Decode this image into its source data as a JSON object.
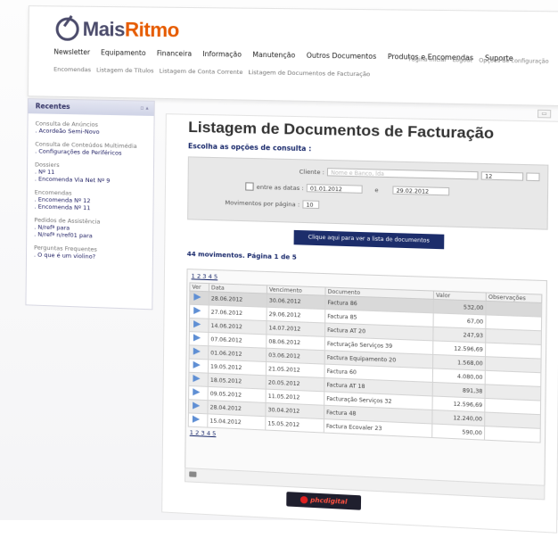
{
  "logo": {
    "part1": "Mais",
    "part2": "Ritmo"
  },
  "topnav": [
    "Newsletter",
    "Equipamento",
    "Financeira",
    "Informação",
    "Manutenção",
    "Outros Documentos",
    "Produtos e Encomendas",
    "Suporte"
  ],
  "subnav": [
    "Encomendas",
    "Listagem de Títulos",
    "Listagem de Conta Corrente",
    "Listagem de Documentos de Facturação"
  ],
  "util": [
    "Página Inicial",
    "Logout",
    "Opções de configuração"
  ],
  "sidebar": {
    "title": "Recentes",
    "groups": [
      {
        "title": "Consulta de Anúncios",
        "links": [
          ". Acordeão Semi-Novo"
        ]
      },
      {
        "title": "Consulta de Conteúdos Multimédia",
        "links": [
          ". Configurações de Periféricos"
        ]
      },
      {
        "title": "Dossiers",
        "links": [
          ". Nº 11",
          ". Encomenda Via Net Nº 9"
        ]
      },
      {
        "title": "Encomendas",
        "links": [
          ". Encomenda Nº 12",
          ". Encomenda Nº 11"
        ]
      },
      {
        "title": "Pedidos de Assistência",
        "links": [
          ". N/refª para",
          ". N/refª n/ref01 para"
        ]
      },
      {
        "title": "Perguntas Frequentes",
        "links": [
          ". O que é um violino?"
        ]
      }
    ]
  },
  "main": {
    "title": "Listagem de Documentos de Facturação",
    "subtitle": "Escolha as opções de consulta :",
    "filters": {
      "cliente_label": "Cliente :",
      "cliente_placeholder": "Nome e Banco, lda",
      "cliente_code": "12",
      "datas_label": "entre as datas :",
      "date_from": "01.01.2012",
      "date_sep": "e",
      "date_to": "29.02.2012",
      "per_page_label": "Movimentos por página :",
      "per_page": "10"
    },
    "submit_label": "Clique aqui para ver a lista de documentos",
    "count": "44 movimentos. Página 1 de 5",
    "pager": "1 2 3 4 5",
    "columns": [
      "Ver",
      "Data",
      "Vencimento",
      "Documento",
      "Valor",
      "Observações"
    ],
    "rows": [
      {
        "data": "28.06.2012",
        "venc": "30.06.2012",
        "doc": "Factura 86",
        "valor": "532,00"
      },
      {
        "data": "27.06.2012",
        "venc": "29.06.2012",
        "doc": "Factura 85",
        "valor": "67,00"
      },
      {
        "data": "14.06.2012",
        "venc": "14.07.2012",
        "doc": "Factura AT 20",
        "valor": "247,93"
      },
      {
        "data": "07.06.2012",
        "venc": "08.06.2012",
        "doc": "Facturação Serviços 39",
        "valor": "12.596,69"
      },
      {
        "data": "01.06.2012",
        "venc": "03.06.2012",
        "doc": "Factura Equipamento 20",
        "valor": "1.568,00"
      },
      {
        "data": "19.05.2012",
        "venc": "21.05.2012",
        "doc": "Factura 60",
        "valor": "4.080,00"
      },
      {
        "data": "18.05.2012",
        "venc": "20.05.2012",
        "doc": "Factura AT 18",
        "valor": "891,38"
      },
      {
        "data": "09.05.2012",
        "venc": "11.05.2012",
        "doc": "Facturação Serviços 32",
        "valor": "12.596,69"
      },
      {
        "data": "28.04.2012",
        "venc": "30.04.2012",
        "doc": "Factura 48",
        "valor": "12.240,00"
      },
      {
        "data": "15.04.2012",
        "venc": "15.05.2012",
        "doc": "Factura Ecovaler 23",
        "valor": "590,00"
      }
    ]
  },
  "brand": "phcdigital",
  "colors": {
    "accent": "#e65b00",
    "navy": "#1c2d6b",
    "link": "#1a2a6c",
    "play": "#5f8fd4"
  }
}
